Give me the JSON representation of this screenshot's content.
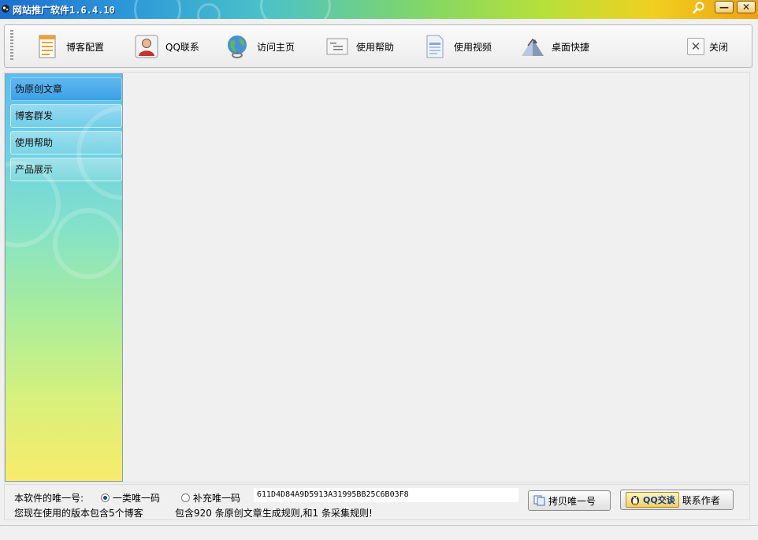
{
  "window": {
    "title": "网站推广软件1.6.4.10"
  },
  "toolbar": {
    "items": [
      {
        "label": "博客配置",
        "icon": "document-list-icon"
      },
      {
        "label": "QQ联系",
        "icon": "user-avatar-icon"
      },
      {
        "label": "访问主页",
        "icon": "globe-icon"
      },
      {
        "label": "使用帮助",
        "icon": "help-document-icon"
      },
      {
        "label": "使用视频",
        "icon": "video-document-icon"
      },
      {
        "label": "桌面快捷",
        "icon": "shortcut-arrow-icon"
      }
    ],
    "close_label": "关闭"
  },
  "sidebar": {
    "items": [
      {
        "label": "伪原创文章"
      },
      {
        "label": "博客群发"
      },
      {
        "label": "使用帮助"
      },
      {
        "label": "产品展示"
      }
    ]
  },
  "footer": {
    "uid_label": "本软件的唯一号:",
    "radio1": "一类唯一码",
    "radio2": "补充唯一码",
    "uid_value": "611D4D84A9D5913A31995BB25C6B03F8",
    "copy_button": "拷贝唯一号",
    "qq_badge": "QQ交谈",
    "contact_label": "联系作者",
    "version_info": "您现在使用的版本包含5个博客",
    "rules_info": "包含920 条原创文章生成规则,和1 条采集规则!"
  },
  "colors": {
    "titlebar_start": "#1e6fd0",
    "titlebar_end": "#f0a010",
    "sidebar_top": "#58c0ee",
    "sidebar_bottom": "#f8ec6a"
  }
}
